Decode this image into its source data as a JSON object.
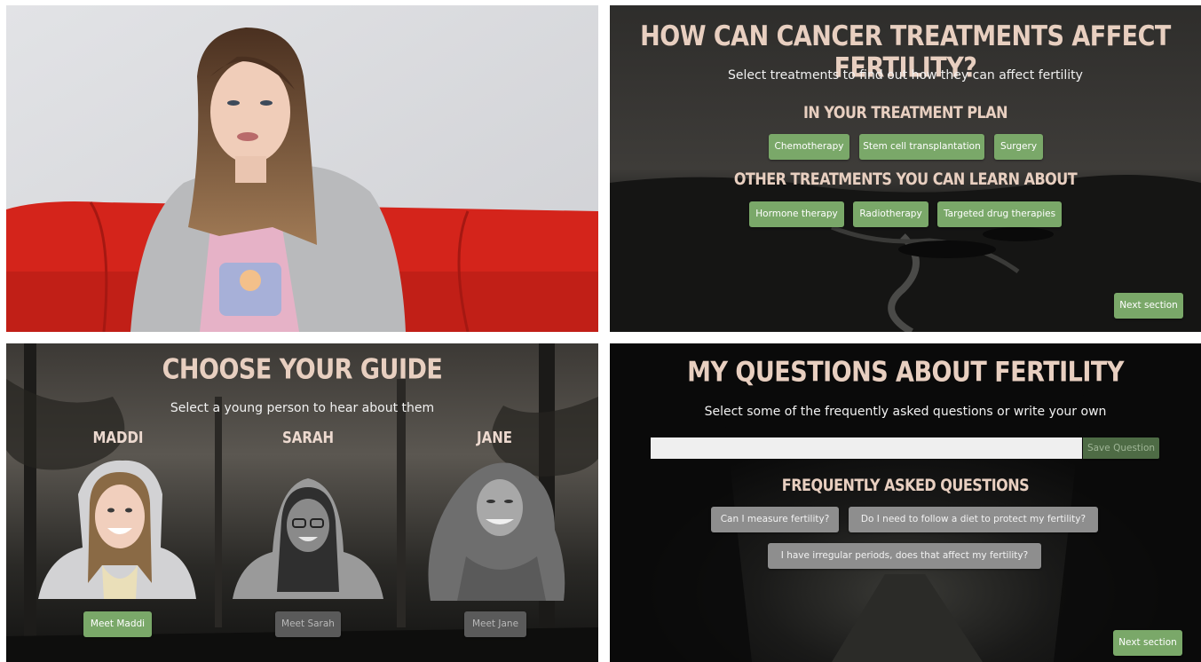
{
  "treatments": {
    "title": "HOW CAN CANCER TREATMENTS AFFECT FERTILITY?",
    "subtitle": "Select treatments to find out how they can affect fertility",
    "plan_heading": "IN YOUR TREATMENT PLAN",
    "plan_items": [
      "Chemotherapy",
      "Stem cell transplantation",
      "Surgery"
    ],
    "other_heading": "OTHER TREATMENTS YOU CAN LEARN ABOUT",
    "other_items": [
      "Hormone therapy",
      "Radiotherapy",
      "Targeted drug therapies"
    ],
    "next_label": "Next section"
  },
  "guide": {
    "title": "CHOOSE YOUR GUIDE",
    "subtitle": "Select a young person to hear about them",
    "people": [
      {
        "name": "MADDI",
        "button": "Meet Maddi"
      },
      {
        "name": "SARAH",
        "button": "Meet Sarah"
      },
      {
        "name": "JANE",
        "button": "Meet Jane"
      }
    ]
  },
  "faq": {
    "title": "MY QUESTIONS ABOUT FERTILITY",
    "subtitle": "Select some of the frequently asked questions or write your own",
    "input_value": "",
    "save_label": "Save Question",
    "faq_heading": "FREQUENTLY ASKED QUESTIONS",
    "questions": [
      "Can I measure fertility?",
      "Do I need to follow a diet to protect my fertility?",
      "I have irregular periods, does that affect my fertility?"
    ],
    "next_label": "Next section"
  },
  "colors": {
    "accent_green": "#7aa869",
    "heading_peach": "#e8cfc0",
    "couch_red": "#d8261c",
    "question_gray": "#8e8e8e"
  }
}
